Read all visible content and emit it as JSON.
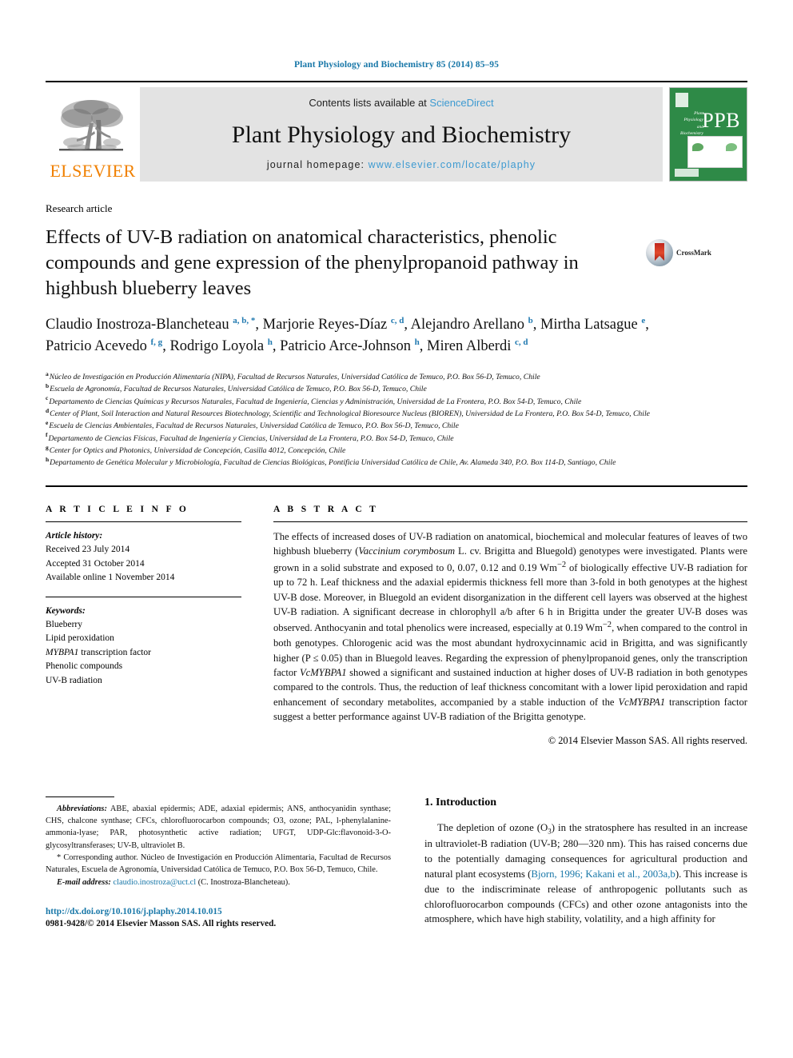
{
  "running_head": "Plant Physiology and Biochemistry 85 (2014) 85–95",
  "masthead": {
    "publisher_name": "ELSEVIER",
    "contents_prefix": "Contents lists available at ",
    "contents_link": "ScienceDirect",
    "journal_title": "Plant Physiology and Biochemistry",
    "homepage_prefix": "journal homepage: ",
    "homepage_url": "www.elsevier.com/locate/plaphy",
    "cover_abbr": "PPB",
    "cover_subtitle": "Plant Physiology and Biochemistry"
  },
  "article": {
    "type": "Research article",
    "title": "Effects of UV-B radiation on anatomical characteristics, phenolic compounds and gene expression of the phenylpropanoid pathway in highbush blueberry leaves",
    "crossmark_label": "CrossMark",
    "authors": [
      {
        "name": "Claudio Inostroza-Blancheteau",
        "sup": "a, b, *"
      },
      {
        "name": "Marjorie Reyes-Díaz",
        "sup": "c, d"
      },
      {
        "name": "Alejandro Arellano",
        "sup": "b"
      },
      {
        "name": "Mirtha Latsague",
        "sup": "e"
      },
      {
        "name": "Patricio Acevedo",
        "sup": "f, g"
      },
      {
        "name": "Rodrigo Loyola",
        "sup": "h"
      },
      {
        "name": "Patricio Arce-Johnson",
        "sup": "h"
      },
      {
        "name": "Miren Alberdi",
        "sup": "c, d"
      }
    ],
    "affiliations": [
      {
        "mark": "a",
        "text": "Núcleo de Investigación en Producción Alimentaría (NIPA), Facultad de Recursos Naturales, Universidad Católica de Temuco, P.O. Box 56-D, Temuco, Chile"
      },
      {
        "mark": "b",
        "text": "Escuela de Agronomía, Facultad de Recursos Naturales, Universidad Católica de Temuco, P.O. Box 56-D, Temuco, Chile"
      },
      {
        "mark": "c",
        "text": "Departamento de Ciencias Químicas y Recursos Naturales, Facultad de Ingeniería, Ciencias y Administración, Universidad de La Frontera, P.O. Box 54-D, Temuco, Chile"
      },
      {
        "mark": "d",
        "text": "Center of Plant, Soil Interaction and Natural Resources Biotechnology, Scientific and Technological Bioresource Nucleus (BIOREN), Universidad de La Frontera, P.O. Box 54-D, Temuco, Chile"
      },
      {
        "mark": "e",
        "text": "Escuela de Ciencias Ambientales, Facultad de Recursos Naturales, Universidad Católica de Temuco, P.O. Box 56-D, Temuco, Chile"
      },
      {
        "mark": "f",
        "text": "Departamento de Ciencias Físicas, Facultad de Ingeniería y Ciencias, Universidad de La Frontera, P.O. Box 54-D, Temuco, Chile"
      },
      {
        "mark": "g",
        "text": "Center for Optics and Photonics, Universidad de Concepción, Casilla 4012, Concepción, Chile"
      },
      {
        "mark": "h",
        "text": "Departamento de Genética Molecular y Microbiología, Facultad de Ciencias Biológicas, Pontificia Universidad Católica de Chile, Av. Alameda 340, P.O. Box 114-D, Santiago, Chile"
      }
    ]
  },
  "article_info": {
    "heading": "A R T I C L E   I N F O",
    "history_label": "Article history:",
    "history": [
      "Received 23 July 2014",
      "Accepted 31 October 2014",
      "Available online 1 November 2014"
    ],
    "keywords_label": "Keywords:",
    "keywords": [
      "Blueberry",
      "Lipid peroxidation",
      "MYBPA1 transcription factor",
      "Phenolic compounds",
      "UV-B radiation"
    ]
  },
  "abstract": {
    "heading": "A B S T R A C T",
    "text_parts": [
      {
        "t": "The effects of increased doses of UV-B radiation on anatomical, biochemical and molecular features of leaves of two highbush blueberry ("
      },
      {
        "t": "Vaccinium corymbosum",
        "i": true
      },
      {
        "t": " L. cv. Brigitta and Bluegold) genotypes were investigated. Plants were grown in a solid substrate and exposed to 0, 0.07, 0.12 and 0.19 Wm"
      },
      {
        "t": "−2",
        "sup": true
      },
      {
        "t": " of biologically effective UV-B radiation for up to 72 h. Leaf thickness and the adaxial epidermis thickness fell more than 3-fold in both genotypes at the highest UV-B dose. Moreover, in Bluegold an evident disorganization in the different cell layers was observed at the highest UV-B radiation. A significant decrease in chlorophyll a/b after 6 h in Brigitta under the greater UV-B doses was observed. Anthocyanin and total phenolics were increased, especially at 0.19 Wm"
      },
      {
        "t": "−2",
        "sup": true
      },
      {
        "t": ", when compared to the control in both genotypes. Chlorogenic acid was the most abundant hydroxycinnamic acid in Brigitta, and was significantly higher (P ≤ 0.05) than in Bluegold leaves. Regarding the expression of phenylpropanoid genes, only the transcription factor "
      },
      {
        "t": "VcMYBPA1",
        "i": true
      },
      {
        "t": " showed a significant and sustained induction at higher doses of UV-B radiation in both genotypes compared to the controls. Thus, the reduction of leaf thickness concomitant with a lower lipid peroxidation and rapid enhancement of secondary metabolites, accompanied by a stable induction of the "
      },
      {
        "t": "VcMYBPA1",
        "i": true
      },
      {
        "t": " transcription factor suggest a better performance against UV-B radiation of the Brigitta genotype."
      }
    ],
    "copyright": "© 2014 Elsevier Masson SAS. All rights reserved."
  },
  "footnotes": {
    "abbreviations_label": "Abbreviations:",
    "abbreviations_text": " ABE, abaxial epidermis; ADE, adaxial epidermis; ANS, anthocyanidin synthase; CHS, chalcone synthase; CFCs, chlorofluorocarbon compounds; O3, ozone; PAL, l-phenylalanine-ammonia-lyase; PAR, photosynthetic active radiation; UFGT, UDP-Glc:flavonoid-3-O-glycosyltransferases; UV-B, ultraviolet B.",
    "corresponding_marker": "*",
    "corresponding_text": " Corresponding author. Núcleo de Investigación en Producción Alimentaria, Facultad de Recursos Naturales, Escuela de Agronomía, Universidad Católica de Temuco, P.O. Box 56-D, Temuco, Chile.",
    "email_label": "E-mail address:",
    "email": "claudio.inostroza@uct.cl",
    "email_suffix": " (C. Inostroza-Blancheteau)."
  },
  "footer": {
    "doi": "http://dx.doi.org/10.1016/j.plaphy.2014.10.015",
    "issn": "0981-9428/© 2014 Elsevier Masson SAS. All rights reserved."
  },
  "introduction": {
    "number_title": "1. Introduction",
    "paragraph_parts": [
      {
        "t": "The depletion of ozone (O"
      },
      {
        "t": "3",
        "sub": true
      },
      {
        "t": ") in the stratosphere has resulted in an increase in ultraviolet-B radiation (UV-B; 280—320 nm). This has raised concerns due to the potentially damaging consequences for agricultural production and natural plant ecosystems ("
      },
      {
        "t": "Bjorn, 1996; Kakani et al., 2003a,b",
        "link": true
      },
      {
        "t": "). This increase is due to the indiscriminate release of anthropogenic pollutants such as chlorofluorocarbon compounds (CFCs) and other ozone antagonists into the atmosphere, which have high stability, volatility, and a high affinity for"
      }
    ]
  },
  "colors": {
    "link_blue": "#1877a8",
    "sciencedirect_blue": "#3d9ad1",
    "elsevier_orange": "#f08000",
    "superscript_blue": "#2079b0",
    "band_gray": "#e3e3e3",
    "cover_green": "#2e8a47"
  }
}
